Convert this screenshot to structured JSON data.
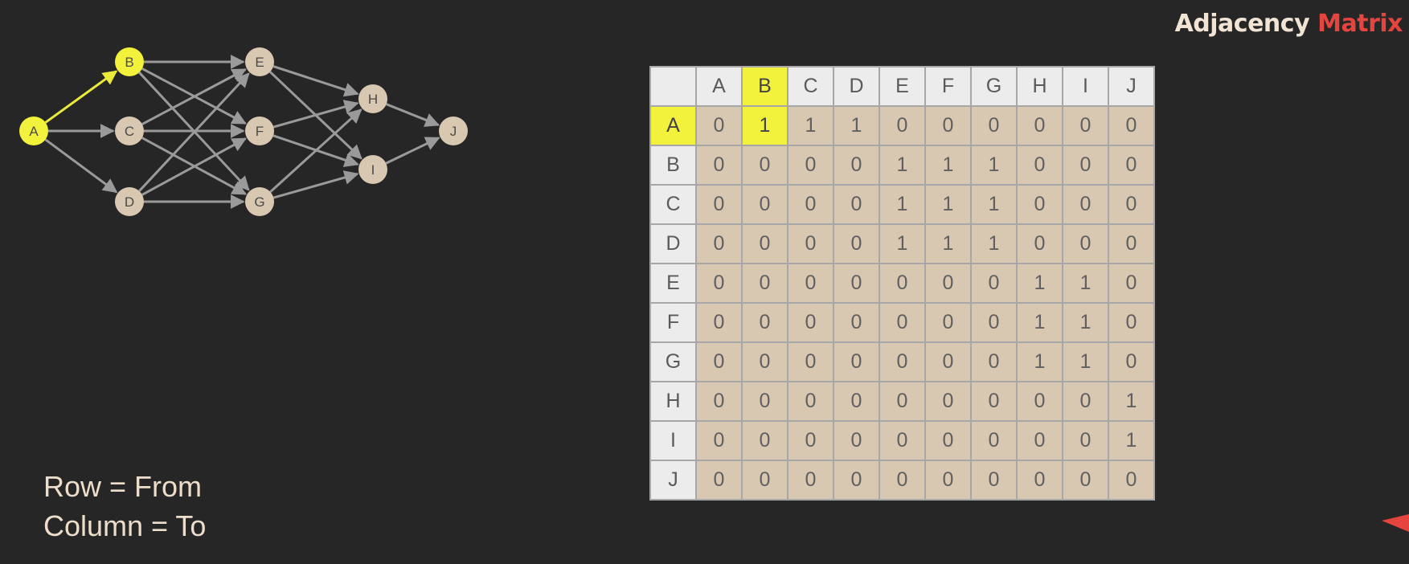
{
  "title": {
    "part1": "Adjacency",
    "part2": "Matrix"
  },
  "graph": {
    "nodes": [
      {
        "id": "A",
        "highlighted": true
      },
      {
        "id": "B",
        "highlighted": true
      },
      {
        "id": "C",
        "highlighted": false
      },
      {
        "id": "D",
        "highlighted": false
      },
      {
        "id": "E",
        "highlighted": false
      },
      {
        "id": "F",
        "highlighted": false
      },
      {
        "id": "G",
        "highlighted": false
      },
      {
        "id": "H",
        "highlighted": false
      },
      {
        "id": "I",
        "highlighted": false
      },
      {
        "id": "J",
        "highlighted": false
      }
    ],
    "edges": [
      {
        "from": "A",
        "to": "B",
        "highlighted": true
      },
      {
        "from": "A",
        "to": "C",
        "highlighted": false
      },
      {
        "from": "A",
        "to": "D",
        "highlighted": false
      },
      {
        "from": "B",
        "to": "E",
        "highlighted": false
      },
      {
        "from": "B",
        "to": "F",
        "highlighted": false
      },
      {
        "from": "B",
        "to": "G",
        "highlighted": false
      },
      {
        "from": "C",
        "to": "E",
        "highlighted": false
      },
      {
        "from": "C",
        "to": "F",
        "highlighted": false
      },
      {
        "from": "C",
        "to": "G",
        "highlighted": false
      },
      {
        "from": "D",
        "to": "E",
        "highlighted": false
      },
      {
        "from": "D",
        "to": "F",
        "highlighted": false
      },
      {
        "from": "D",
        "to": "G",
        "highlighted": false
      },
      {
        "from": "E",
        "to": "H",
        "highlighted": false
      },
      {
        "from": "E",
        "to": "I",
        "highlighted": false
      },
      {
        "from": "F",
        "to": "H",
        "highlighted": false
      },
      {
        "from": "F",
        "to": "I",
        "highlighted": false
      },
      {
        "from": "G",
        "to": "H",
        "highlighted": false
      },
      {
        "from": "G",
        "to": "I",
        "highlighted": false
      },
      {
        "from": "H",
        "to": "J",
        "highlighted": false
      },
      {
        "from": "I",
        "to": "J",
        "highlighted": false
      }
    ]
  },
  "matrix": {
    "labels": [
      "A",
      "B",
      "C",
      "D",
      "E",
      "F",
      "G",
      "H",
      "I",
      "J"
    ],
    "rows": [
      [
        0,
        1,
        1,
        1,
        0,
        0,
        0,
        0,
        0,
        0
      ],
      [
        0,
        0,
        0,
        0,
        1,
        1,
        1,
        0,
        0,
        0
      ],
      [
        0,
        0,
        0,
        0,
        1,
        1,
        1,
        0,
        0,
        0
      ],
      [
        0,
        0,
        0,
        0,
        1,
        1,
        1,
        0,
        0,
        0
      ],
      [
        0,
        0,
        0,
        0,
        0,
        0,
        0,
        1,
        1,
        0
      ],
      [
        0,
        0,
        0,
        0,
        0,
        0,
        0,
        1,
        1,
        0
      ],
      [
        0,
        0,
        0,
        0,
        0,
        0,
        0,
        1,
        1,
        0
      ],
      [
        0,
        0,
        0,
        0,
        0,
        0,
        0,
        0,
        0,
        1
      ],
      [
        0,
        0,
        0,
        0,
        0,
        0,
        0,
        0,
        0,
        1
      ],
      [
        0,
        0,
        0,
        0,
        0,
        0,
        0,
        0,
        0,
        0
      ]
    ],
    "highlight": {
      "row": "A",
      "col": "B"
    }
  },
  "legend": {
    "line1": "Row = From",
    "line2": "Column = To"
  },
  "colors": {
    "background": "#262626",
    "node_fill": "#d9c8b1",
    "node_highlight": "#f2f23c",
    "edge": "#9a9a9a",
    "edge_highlight": "#eaea3a",
    "title_primary": "#f1e4d4",
    "title_accent": "#e6453f",
    "cell_fill": "#d9c8b1",
    "header_fill": "#ececec"
  }
}
